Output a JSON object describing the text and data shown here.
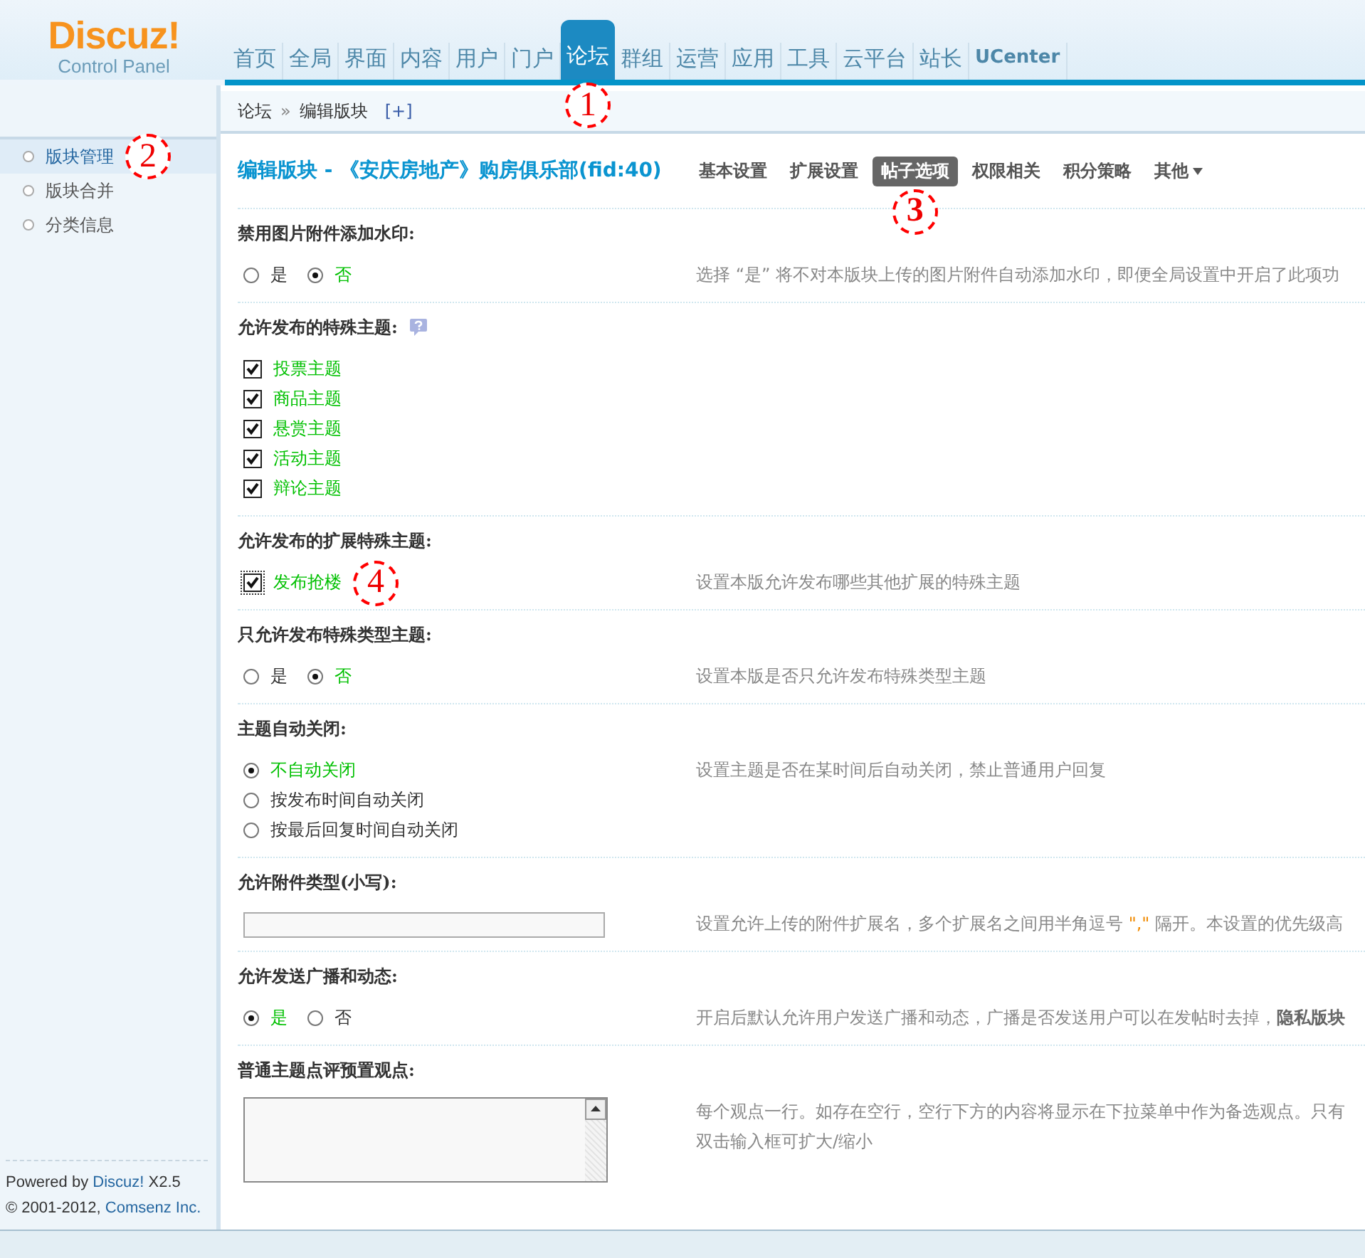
{
  "logo": {
    "name": "Discuz!",
    "subtitle": "Control Panel"
  },
  "nav": [
    {
      "label": "首页",
      "selected": false
    },
    {
      "label": "全局",
      "selected": false
    },
    {
      "label": "界面",
      "selected": false
    },
    {
      "label": "内容",
      "selected": false
    },
    {
      "label": "用户",
      "selected": false
    },
    {
      "label": "门户",
      "selected": false
    },
    {
      "label": "论坛",
      "selected": true,
      "marker": "1"
    },
    {
      "label": "群组",
      "selected": false
    },
    {
      "label": "运营",
      "selected": false
    },
    {
      "label": "应用",
      "selected": false
    },
    {
      "label": "工具",
      "selected": false
    },
    {
      "label": "云平台",
      "selected": false
    },
    {
      "label": "站长",
      "selected": false
    },
    {
      "label": "UCenter",
      "selected": false
    }
  ],
  "breadcrumb": {
    "items": [
      "论坛",
      "编辑版块"
    ],
    "separator": "»",
    "add": "[+]"
  },
  "sidebar": {
    "items": [
      {
        "label": "版块管理",
        "selected": true,
        "marker": "2"
      },
      {
        "label": "版块合并",
        "selected": false
      },
      {
        "label": "分类信息",
        "selected": false
      }
    ],
    "footer": {
      "powered": "Powered by",
      "link": "Discuz!",
      "version": "X2.5",
      "copyright": "© 2001-2012,",
      "company": "Comsenz Inc."
    }
  },
  "page_title": "编辑版块 - 《安庆房地产》购房俱乐部(fid:40)",
  "tabs": [
    {
      "label": "基本设置",
      "selected": false
    },
    {
      "label": "扩展设置",
      "selected": false
    },
    {
      "label": "帖子选项",
      "selected": true,
      "marker": "3"
    },
    {
      "label": "权限相关",
      "selected": false
    },
    {
      "label": "积分策略",
      "selected": false
    },
    {
      "label": "其他",
      "selected": false,
      "kind": "dropdown"
    }
  ],
  "settings": [
    {
      "kind": "radio",
      "title": "禁用图片附件添加水印:",
      "options": [
        {
          "label": "是",
          "selected": false
        },
        {
          "label": "否",
          "selected": true
        }
      ],
      "tip": "选择 “是” 将不对本版块上传的图片附件自动添加水印，即便全局设置中开启了此项功"
    },
    {
      "kind": "checkbox",
      "title": "允许发布的特殊主题:",
      "help": true,
      "options": [
        {
          "label": "投票主题",
          "checked": true
        },
        {
          "label": "商品主题",
          "checked": true
        },
        {
          "label": "悬赏主题",
          "checked": true
        },
        {
          "label": "活动主题",
          "checked": true
        },
        {
          "label": "辩论主题",
          "checked": true
        }
      ]
    },
    {
      "kind": "checkbox",
      "title": "允许发布的扩展特殊主题:",
      "options": [
        {
          "label": "发布抢楼",
          "checked": true,
          "marker": "4"
        }
      ],
      "tip": "设置本版允许发布哪些其他扩展的特殊主题"
    },
    {
      "kind": "radio",
      "title": "只允许发布特殊类型主题:",
      "options": [
        {
          "label": "是",
          "selected": false
        },
        {
          "label": "否",
          "selected": true
        }
      ],
      "tip": "设置本版是否只允许发布特殊类型主题"
    },
    {
      "kind": "radio_list",
      "title": "主题自动关闭:",
      "options": [
        {
          "label": "不自动关闭",
          "selected": true
        },
        {
          "label": "按发布时间自动关闭",
          "selected": false
        },
        {
          "label": "按最后回复时间自动关闭",
          "selected": false
        }
      ],
      "tip": "设置主题是否在某时间后自动关闭，禁止普通用户回复"
    },
    {
      "kind": "text",
      "title": "允许附件类型(小写):",
      "tip_segments": [
        {
          "kind": "plain",
          "text": "设置允许上传的附件扩展名，多个扩展名之间用半角逗号 "
        },
        {
          "kind": "highlight",
          "text": "\",\""
        },
        {
          "kind": "plain",
          "text": " 隔开。本设置的优先级高"
        }
      ]
    },
    {
      "kind": "radio",
      "title": "允许发送广播和动态:",
      "options": [
        {
          "label": "是",
          "selected": true
        },
        {
          "label": "否",
          "selected": false
        }
      ],
      "tip": "开启后默认允许用户发送广播和动态，广播是否发送用户可以在发帖时去掉，**隐私版块**"
    },
    {
      "kind": "textarea",
      "title": "普通主题点评预置观点:",
      "tip_lines": [
        "每个观点一行。如存在空行，空行下方的内容将显示在下拉菜单中作为备选观点。只有",
        "双击输入框可扩大/缩小"
      ]
    }
  ]
}
